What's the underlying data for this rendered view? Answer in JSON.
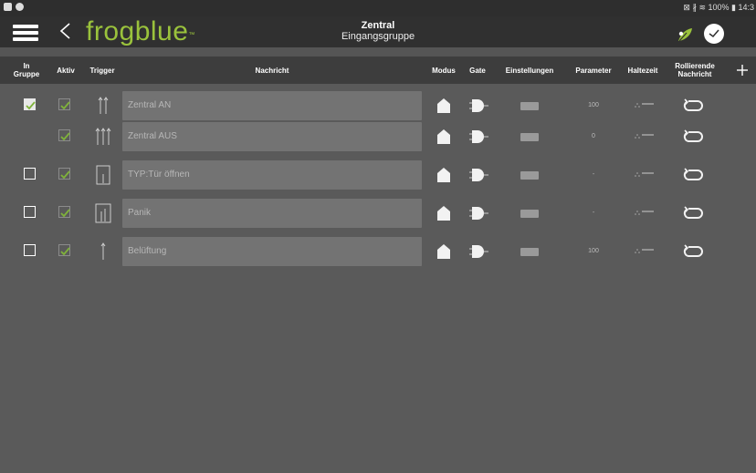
{
  "statusbar": {
    "right_text": "⊠ ∦ ≋ 100% ▮ 14:3"
  },
  "header": {
    "logo": "frogblue",
    "logo_tm": "™",
    "title": "Zentral",
    "subtitle": "Eingangsgruppe"
  },
  "columns": {
    "in_gruppe": "In Gruppe",
    "aktiv": "Aktiv",
    "trigger": "Trigger",
    "nachricht": "Nachricht",
    "modus": "Modus",
    "gate": "Gate",
    "einstellungen": "Einstellungen",
    "parameter": "Parameter",
    "haltezeit": "Haltezeit",
    "rollierende": "Rollierende Nachricht"
  },
  "rows": [
    {
      "in_gruppe": true,
      "show_in_gruppe": true,
      "aktiv": true,
      "trigger": "double-up",
      "message": "Zentral AN",
      "parameter": "100"
    },
    {
      "in_gruppe": false,
      "show_in_gruppe": false,
      "aktiv": true,
      "trigger": "triple-up",
      "message": "Zentral AUS",
      "parameter": "0"
    },
    {
      "in_gruppe": false,
      "show_in_gruppe": true,
      "aktiv": true,
      "trigger": "door-single",
      "message": "TYP:Tür öffnen",
      "parameter": "-"
    },
    {
      "in_gruppe": false,
      "show_in_gruppe": true,
      "aktiv": true,
      "trigger": "door-double",
      "message": "Panik",
      "parameter": "-"
    },
    {
      "in_gruppe": false,
      "show_in_gruppe": true,
      "aktiv": true,
      "trigger": "single-up",
      "message": "Belüftung",
      "parameter": "100"
    }
  ],
  "colors": {
    "accent": "#9ac23c",
    "checkbox_active": "#7fb23a"
  }
}
